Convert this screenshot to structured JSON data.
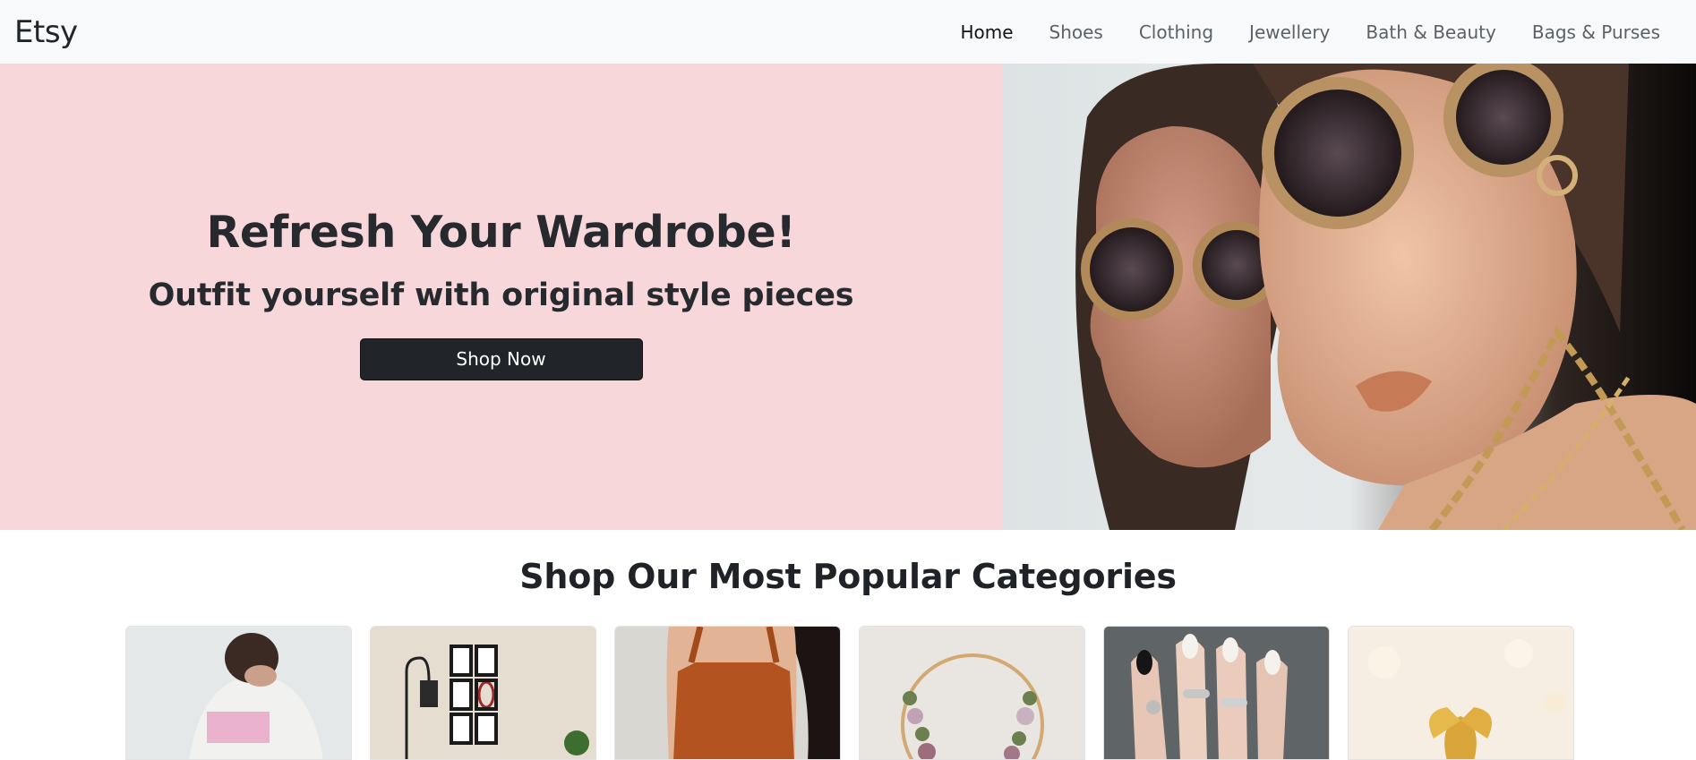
{
  "navbar": {
    "brand": "Etsy",
    "links": [
      {
        "label": "Home",
        "active": true
      },
      {
        "label": "Shoes",
        "active": false
      },
      {
        "label": "Clothing",
        "active": false
      },
      {
        "label": "Jewellery",
        "active": false
      },
      {
        "label": "Bath & Beauty",
        "active": false
      },
      {
        "label": "Bags & Purses",
        "active": false
      }
    ]
  },
  "hero": {
    "title": "Refresh Your Wardrobe!",
    "subtitle": "Outfit yourself with original style pieces",
    "button_label": "Shop Now",
    "background_color": "#f8d7da",
    "image_icon": "fashion-photo"
  },
  "categories": {
    "title": "Shop Our Most Popular Categories",
    "cards": [
      {
        "image_icon": "clothing-photo"
      },
      {
        "image_icon": "home-decor-photo"
      },
      {
        "image_icon": "knitwear-photo"
      },
      {
        "image_icon": "wreath-photo"
      },
      {
        "image_icon": "rings-photo"
      },
      {
        "image_icon": "gifts-photo"
      }
    ]
  },
  "colors": {
    "navbar_bg": "#f8f9fa",
    "button_bg": "#212529",
    "text_dark": "#212529"
  }
}
